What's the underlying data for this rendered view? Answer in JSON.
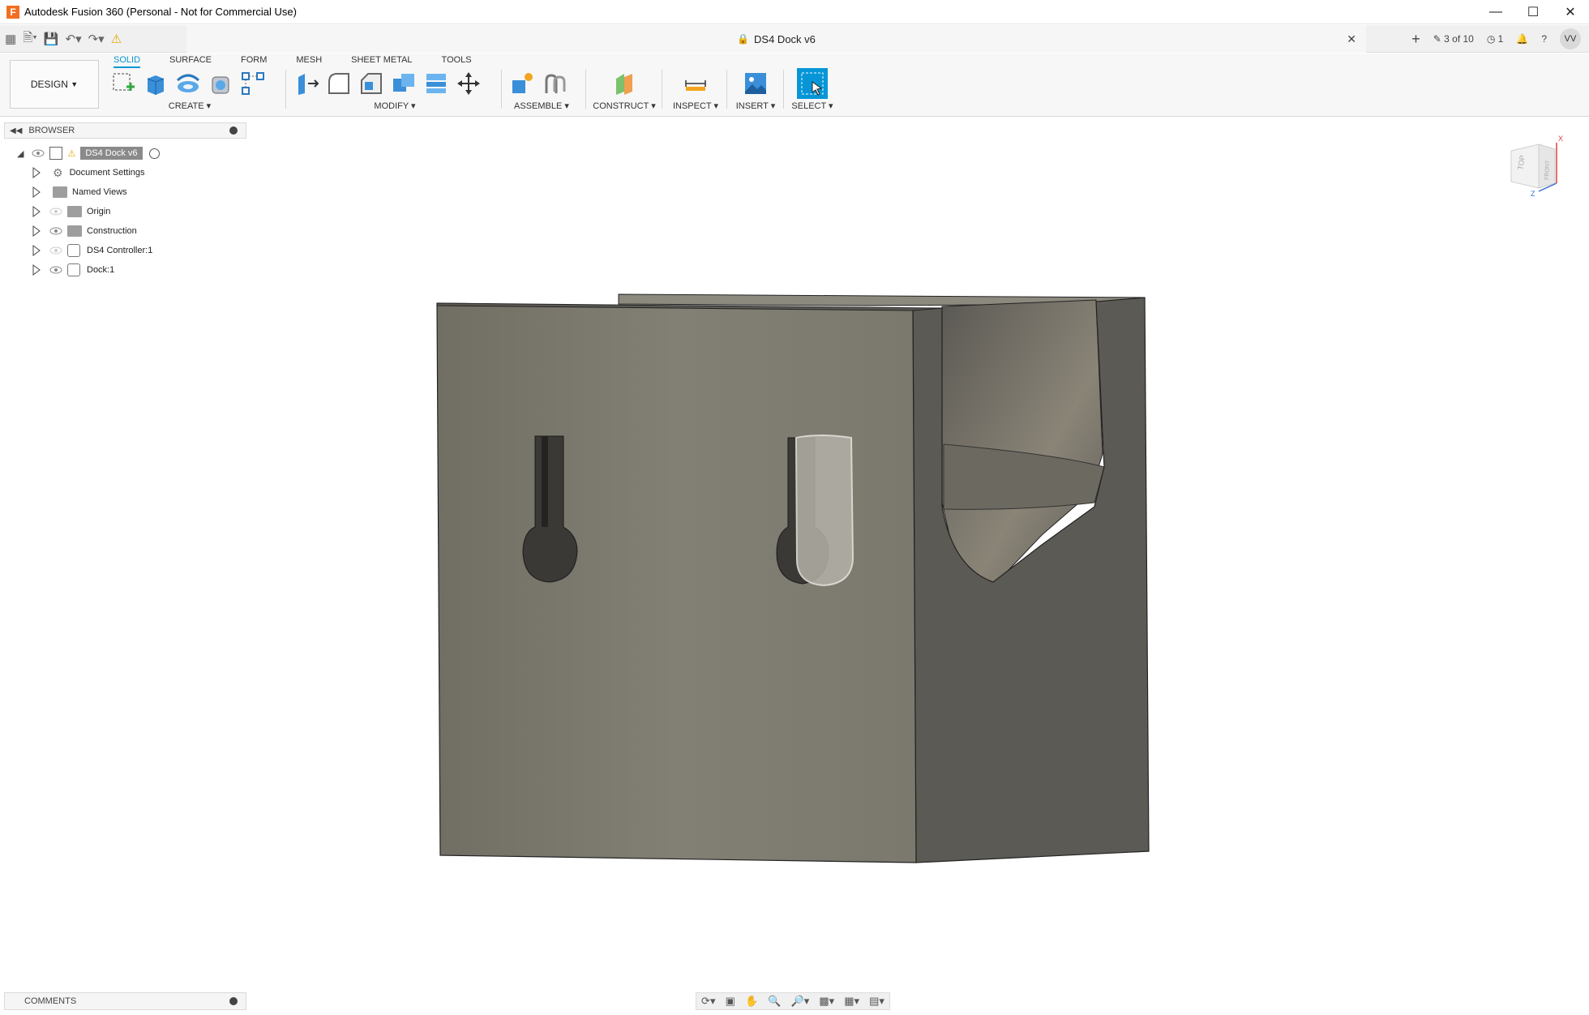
{
  "window": {
    "title": "Autodesk Fusion 360 (Personal - Not for Commercial Use)",
    "logo_letter": "F"
  },
  "app_bar": {
    "document_tab": "DS4 Dock v6",
    "version_counter": "3 of 10",
    "job_count": "1",
    "user_initials": "VV"
  },
  "toolbar": {
    "workspace": "DESIGN",
    "tabs": [
      "SOLID",
      "SURFACE",
      "FORM",
      "MESH",
      "SHEET METAL",
      "TOOLS"
    ],
    "active_tab": "SOLID",
    "groups": {
      "create": "CREATE",
      "modify": "MODIFY",
      "assemble": "ASSEMBLE",
      "construct": "CONSTRUCT",
      "inspect": "INSPECT",
      "insert": "INSERT",
      "select": "SELECT"
    }
  },
  "browser": {
    "title": "BROWSER",
    "root": "DS4 Dock v6",
    "items": [
      {
        "label": "Document Settings",
        "icon": "gear-icon"
      },
      {
        "label": "Named Views",
        "icon": "folder-icon"
      },
      {
        "label": "Origin",
        "icon": "folder-icon"
      },
      {
        "label": "Construction",
        "icon": "folder-icon"
      },
      {
        "label": "DS4 Controller:1",
        "icon": "component-icon"
      },
      {
        "label": "Dock:1",
        "icon": "component-icon"
      }
    ]
  },
  "viewcube": {
    "top": "TOP",
    "front": "FRONT",
    "x_axis": "X",
    "z_axis": "Z"
  },
  "comments": {
    "title": "COMMENTS"
  },
  "colors": {
    "accent": "#0696d7",
    "model_front": "#7d7a6f",
    "model_side": "#5c5a54"
  }
}
